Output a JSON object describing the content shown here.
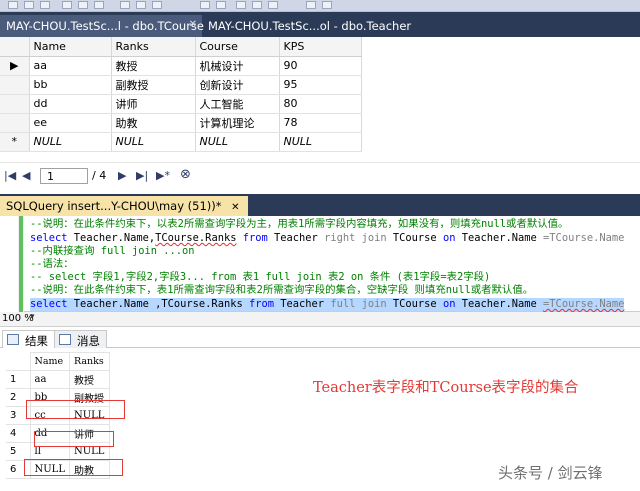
{
  "doc_tabs": [
    {
      "label": "MAY-CHOU.TestSc...l - dbo.TCourse",
      "close": "✕"
    },
    {
      "label": "MAY-CHOU.TestSc...ol - dbo.Teacher",
      "close": ""
    }
  ],
  "top_grid": {
    "columns": [
      "Name",
      "Ranks",
      "Course",
      "KPS"
    ],
    "rows": [
      {
        "marker": "▶",
        "name": "aa",
        "ranks": "教授",
        "course": "机械设计",
        "kps": "90"
      },
      {
        "marker": "",
        "name": "bb",
        "ranks": "副教授",
        "course": "创新设计",
        "kps": "95"
      },
      {
        "marker": "",
        "name": "dd",
        "ranks": "讲师",
        "course": "人工智能",
        "kps": "80"
      },
      {
        "marker": "",
        "name": "ee",
        "ranks": "助教",
        "course": "计算机理论",
        "kps": "78"
      },
      {
        "marker": "*",
        "name": "NULL",
        "ranks": "NULL",
        "course": "NULL",
        "kps": "NULL"
      }
    ]
  },
  "nav": {
    "first": "|◀",
    "prev": "◀",
    "current": "1",
    "total": "/ 4",
    "next": "▶",
    "next_new": "▶|",
    "last": "▶*",
    "stop": "⊗"
  },
  "query_tab": {
    "label": "SQLQuery insert...Y-CHOU\\may (51))*",
    "close": "✕"
  },
  "code": {
    "line1": "--说明：在此条件约束下，以表2所需查询字段为主，用表1所需字段内容填充，如果没有，则填充null或者默认值。",
    "line2_kw1": "select",
    "line2_a": " Teacher.Name,",
    "line2_b": "TCourse.Ranks",
    "line2_kw2": " from",
    "line2_c": " Teacher ",
    "line2_kw3": "right join",
    "line2_d": " TCourse ",
    "line2_kw4": "on",
    "line2_e": " Teacher.Name ",
    "line2_f": "=TCourse.Name",
    "line3": "--内联接查询 full join ...on",
    "line4": "--语法：",
    "line5": "-- select 字段1,字段2,字段3... from 表1 full join 表2 on 条件 (表1字段=表2字段)",
    "line6": "--说明：在此条件约束下，表1所需查询字段和表2所需查询字段的集合，空缺字段 则填充null或者默认值。",
    "line7_kw1": "select",
    "line7_a": " Teacher.Name ,",
    "line7_b": "TCourse.Ranks",
    "line7_kw2": " from",
    "line7_c": " Teacher ",
    "line7_kw3": "full join",
    "line7_d": " TCourse ",
    "line7_kw4": "on",
    "line7_e": " Teacher.Name ",
    "line7_f": "=TCourse.Name"
  },
  "zoom": {
    "label": "100 %",
    "arrow": "▾"
  },
  "result_tabs": [
    {
      "label": "结果"
    },
    {
      "label": "消息"
    }
  ],
  "results": {
    "columns": [
      "Name",
      "Ranks"
    ],
    "rows": [
      {
        "n": "1",
        "name": "aa",
        "ranks": "教授"
      },
      {
        "n": "2",
        "name": "bb",
        "ranks": "副教授"
      },
      {
        "n": "3",
        "name": "cc",
        "ranks": "NULL"
      },
      {
        "n": "4",
        "name": "dd",
        "ranks": "讲师"
      },
      {
        "n": "5",
        "name": "ll",
        "ranks": "NULL"
      },
      {
        "n": "6",
        "name": "NULL",
        "ranks": "助教"
      }
    ]
  },
  "annotation": "Teacher表字段和TCourse表字段的集合",
  "watermark": "头条号 / 剑云锋",
  "colors": {
    "tab_bar": "#2b3a57",
    "query_tab": "#f7e3a8",
    "keyword": "#0000ff",
    "comment": "#008000",
    "annotation": "#e53935"
  }
}
